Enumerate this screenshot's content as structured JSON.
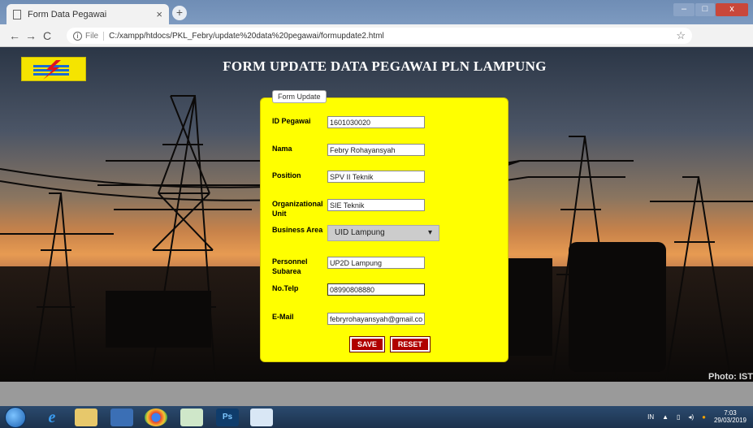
{
  "browser": {
    "tab_title": "Form Data Pegawai",
    "tab_close": "×",
    "new_tab": "+",
    "url_scheme": "File",
    "url": "C:/xampp/htdocs/PKL_Febry/update%20data%20pegawai/formupdate2.html",
    "nav": {
      "back": "←",
      "forward": "→",
      "reload": "C"
    },
    "window_controls": {
      "minimize": "–",
      "maximize": "□",
      "close": "x"
    }
  },
  "page": {
    "headline": "FORM UPDATE DATA PEGAWAI PLN LAMPUNG",
    "photo_credit": "Photo: IST"
  },
  "form": {
    "legend": "Form Update",
    "fields": {
      "id_pegawai": {
        "label": "ID Pegawai",
        "value": "1601030020"
      },
      "nama": {
        "label": "Nama",
        "value": "Febry Rohayansyah"
      },
      "position": {
        "label": "Position",
        "value": "SPV II Teknik"
      },
      "org_unit": {
        "label": "Organizational Unit",
        "value": "SIE Teknik"
      },
      "business_area": {
        "label": "Business Area",
        "value": "UID Lampung"
      },
      "personnel_subarea": {
        "label": "Personnel Subarea",
        "value": "UP2D Lampung"
      },
      "no_telp": {
        "label": "No.Telp",
        "value": "08990808880"
      },
      "email": {
        "label": "E-Mail",
        "value": "febryrohayansyah@gmail.co"
      }
    },
    "save_label": "SAVE",
    "reset_label": "RESET"
  },
  "taskbar": {
    "language": "IN",
    "time": "7:03",
    "date": "29/03/2019"
  },
  "colors": {
    "form_bg": "#ffff00",
    "button_bg": "#b00000",
    "logo_bg": "#f5e400"
  }
}
